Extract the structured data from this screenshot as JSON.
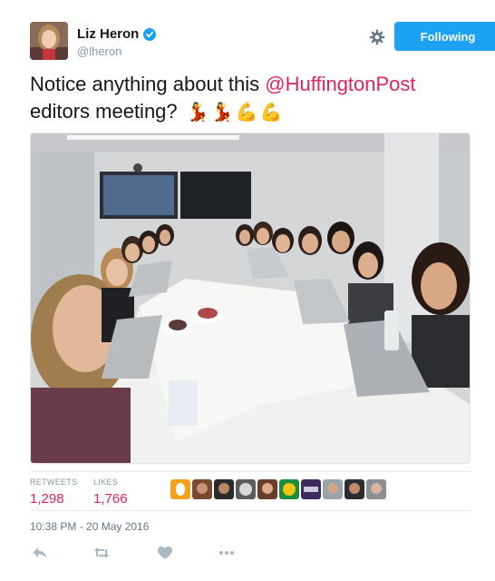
{
  "author": {
    "display_name": "Liz Heron",
    "handle": "@lheron",
    "verified": true
  },
  "follow_button": {
    "label": "Following"
  },
  "icons": {
    "settings": "gear-icon",
    "reply": "reply-icon",
    "retweet": "retweet-icon",
    "like": "heart-icon",
    "more": "more-icon"
  },
  "tweet": {
    "text_before": "Notice anything about this ",
    "mention": "@HuffingtonPost",
    "text_after": "editors meeting? ",
    "emojis": [
      "💃",
      "💃",
      "💪",
      "💪"
    ]
  },
  "stats": {
    "retweets_label": "RETWEETS",
    "retweets_value": "1,298",
    "likes_label": "LIKES",
    "likes_value": "1,766"
  },
  "timestamp": "10:38 PM - 20 May 2016",
  "colors": {
    "brand_blue": "#1da1f2",
    "mention_red": "#e0245e",
    "muted_gray": "#8899a6"
  }
}
